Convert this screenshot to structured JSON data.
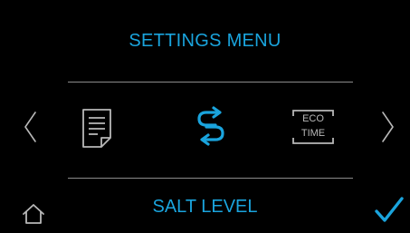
{
  "header": {
    "title": "SETTINGS MENU"
  },
  "carousel": {
    "items": [
      {
        "icon": "document-icon"
      },
      {
        "icon": "salt-swap-icon",
        "selected": true
      },
      {
        "icon": "eco-time-icon",
        "text_top": "ECO",
        "text_bottom": "TIME"
      }
    ],
    "selected_label": "SALT LEVEL"
  },
  "footer": {
    "home_icon": "home-icon",
    "confirm_icon": "checkmark-icon"
  },
  "colors": {
    "accent": "#1aa4dd",
    "background": "#000000",
    "icon_gray": "#b8b8b8",
    "divider": "#8a8a8a"
  }
}
